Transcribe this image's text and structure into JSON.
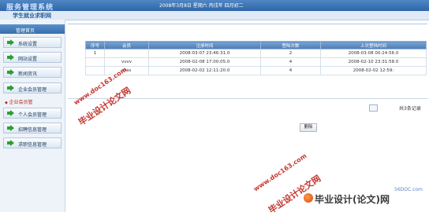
{
  "header": {
    "brand": "服务管理系统",
    "date_text": "2008年3月8日 星期六 丙戌年 四月初二",
    "subtitle": "学生就业求职网"
  },
  "sidebar": {
    "head": "管理首页",
    "items": [
      {
        "label": "系统设置"
      },
      {
        "label": "网站设置"
      },
      {
        "label": "新闻资讯"
      },
      {
        "label": "企业会员管理"
      },
      {
        "label": "个人会员管理"
      },
      {
        "label": "招聘信息管理"
      },
      {
        "label": "求职信息管理"
      }
    ],
    "active_sub": "企业会员管"
  },
  "table": {
    "headers": [
      "序号",
      "会员",
      "注册时间",
      "登陆次数",
      "上次登陆时间"
    ],
    "rows": [
      [
        "1",
        "",
        "2008-03-07 23:46:31.0",
        "2",
        "2008-03-08 00:24:56.0"
      ],
      [
        "",
        "vvvv",
        "2008-02-08 17:00:05.0",
        "4",
        "2008-02-10 23:31:58.0"
      ],
      [
        "",
        "ssss",
        "2008-02-02 12:11:20.0",
        "4",
        "2008-02-02 12:59:"
      ]
    ]
  },
  "pagination": {
    "records": "共3条记录"
  },
  "actions": {
    "delete": "删除"
  },
  "watermarks": {
    "cn": "毕业设计论文网",
    "url": "www.doc163.com"
  },
  "footer": {
    "brand": "毕业设计(论文)网",
    "site": "56DOC.com"
  }
}
